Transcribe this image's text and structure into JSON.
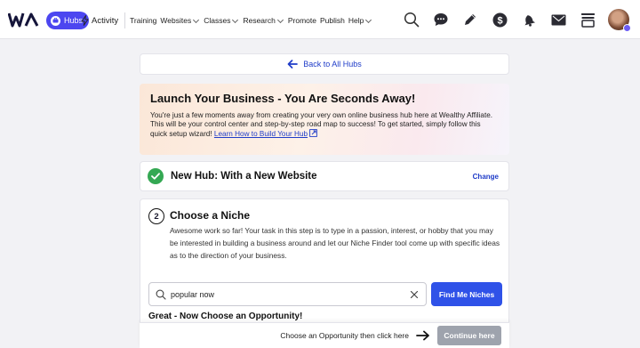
{
  "nav": {
    "hubs_label": "Hubs",
    "activity_label": "Activity",
    "items": [
      {
        "label": "Training",
        "dropdown": false
      },
      {
        "label": "Websites",
        "dropdown": true
      },
      {
        "label": "Classes",
        "dropdown": true
      },
      {
        "label": "Research",
        "dropdown": true
      },
      {
        "label": "Promote",
        "dropdown": false
      },
      {
        "label": "Publish",
        "dropdown": false
      },
      {
        "label": "Help",
        "dropdown": true
      }
    ],
    "right_icons": [
      "search-icon",
      "chat-icon",
      "pencil-icon",
      "dollar-icon",
      "bell-icon",
      "mail-icon",
      "inbox-icon",
      "avatar"
    ],
    "accent_color": "#4c46f0"
  },
  "back": {
    "label": "Back to All Hubs"
  },
  "launch": {
    "title": "Launch Your Business - You Are Seconds Away!",
    "text": "You're just a few moments away from creating your very own online business hub here at Wealthy Affiliate. This will be your control center and step-by-step road map to success! To get started, simply follow this quick setup wizard!",
    "link": "Learn How to Build Your Hub"
  },
  "new_hub": {
    "title": "New Hub: With a New Website",
    "change_label": "Change",
    "status_color": "#34a853"
  },
  "niche": {
    "step": "2",
    "title": "Choose a Niche",
    "text": "Awesome work so far! Your task in this step is to type in a passion, interest, or hobby that you may be interested in building a business around and let our Niche Finder tool come up with specific ideas as to the direction of your business.",
    "search_value": "popular now",
    "find_label": "Find Me Niches",
    "opportunity_title": "Great - Now Choose an Opportunity!"
  },
  "footer": {
    "hint": "Choose an Opportunity then click here",
    "continue_label": "Continue here"
  }
}
